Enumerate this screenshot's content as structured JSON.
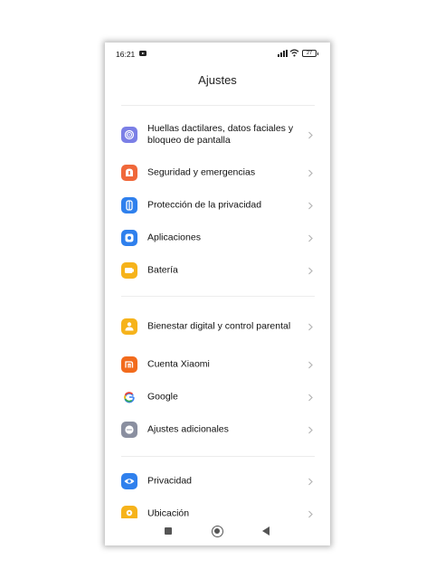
{
  "status": {
    "time": "16:21",
    "battery": "27"
  },
  "title": "Ajustes",
  "items": [
    {
      "label": "Huellas dactilares, datos faciales y bloqueo de pantalla",
      "icon": "fingerprint-icon",
      "color": "#7b7fe6"
    },
    {
      "label": "Seguridad y emergencias",
      "icon": "emergency-icon",
      "color": "#f0683a"
    },
    {
      "label": "Protección de la privacidad",
      "icon": "privacy-protection-icon",
      "color": "#2f80ed"
    },
    {
      "label": "Aplicaciones",
      "icon": "apps-gear-icon",
      "color": "#2f80ed"
    },
    {
      "label": "Batería",
      "icon": "battery-icon",
      "color": "#f6b31b"
    },
    {
      "label": "Bienestar digital y control parental",
      "icon": "wellbeing-icon",
      "color": "#f6b31b"
    },
    {
      "label": "Cuenta Xiaomi",
      "icon": "xiaomi-icon",
      "color": "#f26b1d"
    },
    {
      "label": "Google",
      "icon": "google-icon",
      "color": "#ffffff"
    },
    {
      "label": "Ajustes adicionales",
      "icon": "more-dots-icon",
      "color": "#8a8fa0"
    },
    {
      "label": "Privacidad",
      "icon": "eye-icon",
      "color": "#2f80ed"
    },
    {
      "label": "Ubicación",
      "icon": "location-icon",
      "color": "#f6b31b"
    }
  ]
}
